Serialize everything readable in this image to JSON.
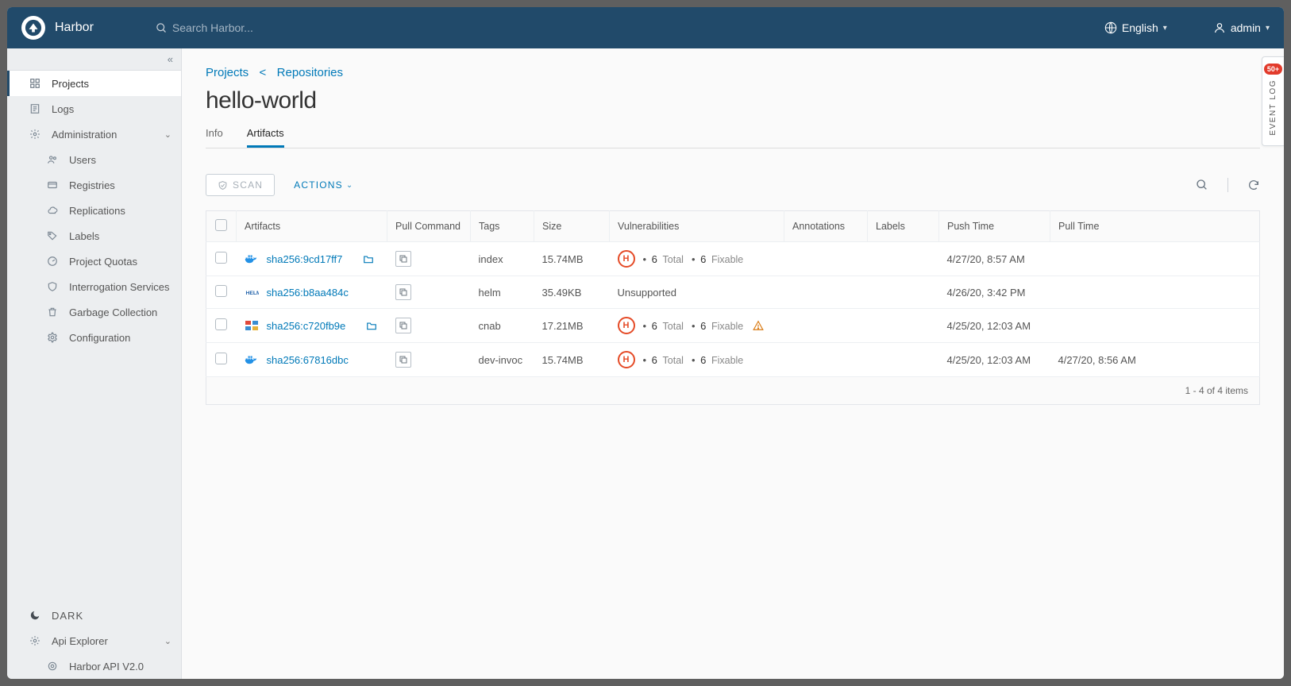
{
  "header": {
    "app_name": "Harbor",
    "search_placeholder": "Search Harbor...",
    "language": "English",
    "user": "admin"
  },
  "sidebar": {
    "projects": "Projects",
    "logs": "Logs",
    "administration": "Administration",
    "admin_items": {
      "users": "Users",
      "registries": "Registries",
      "replications": "Replications",
      "labels": "Labels",
      "project_quotas": "Project Quotas",
      "interrogation": "Interrogation Services",
      "garbage_collection": "Garbage Collection",
      "configuration": "Configuration"
    },
    "dark": "DARK",
    "api_explorer": "Api Explorer",
    "harbor_api": "Harbor API V2.0"
  },
  "breadcrumb": {
    "projects": "Projects",
    "repositories": "Repositories"
  },
  "page_title": "hello-world",
  "tabs": {
    "info": "Info",
    "artifacts": "Artifacts"
  },
  "toolbar": {
    "scan": "SCAN",
    "actions": "ACTIONS"
  },
  "columns": {
    "artifacts": "Artifacts",
    "pull_command": "Pull Command",
    "tags": "Tags",
    "size": "Size",
    "vulnerabilities": "Vulnerabilities",
    "annotations": "Annotations",
    "labels": "Labels",
    "push_time": "Push Time",
    "pull_time": "Pull Time"
  },
  "rows": [
    {
      "type": "docker",
      "hash": "sha256:9cd17ff7",
      "has_folder": true,
      "tag": "index",
      "size": "15.74MB",
      "vuln_severity": "H",
      "vuln_total": "6",
      "vuln_total_label": "Total",
      "vuln_fixable": "6",
      "vuln_fixable_label": "Fixable",
      "vuln_unsupported": "",
      "warn": false,
      "push_time": "4/27/20, 8:57 AM",
      "pull_time": ""
    },
    {
      "type": "helm",
      "hash": "sha256:b8aa484c",
      "has_folder": false,
      "tag": "helm",
      "size": "35.49KB",
      "vuln_severity": "",
      "vuln_total": "",
      "vuln_total_label": "",
      "vuln_fixable": "",
      "vuln_fixable_label": "",
      "vuln_unsupported": "Unsupported",
      "warn": false,
      "push_time": "4/26/20, 3:42 PM",
      "pull_time": ""
    },
    {
      "type": "cnab",
      "hash": "sha256:c720fb9e",
      "has_folder": true,
      "tag": "cnab",
      "size": "17.21MB",
      "vuln_severity": "H",
      "vuln_total": "6",
      "vuln_total_label": "Total",
      "vuln_fixable": "6",
      "vuln_fixable_label": "Fixable",
      "vuln_unsupported": "",
      "warn": true,
      "push_time": "4/25/20, 12:03 AM",
      "pull_time": ""
    },
    {
      "type": "docker",
      "hash": "sha256:67816dbc",
      "has_folder": false,
      "tag": "dev-invoc",
      "size": "15.74MB",
      "vuln_severity": "H",
      "vuln_total": "6",
      "vuln_total_label": "Total",
      "vuln_fixable": "6",
      "vuln_fixable_label": "Fixable",
      "vuln_unsupported": "",
      "warn": false,
      "push_time": "4/25/20, 12:03 AM",
      "pull_time": "4/27/20, 8:56 AM"
    }
  ],
  "footer": "1 - 4 of 4 items",
  "event_log": {
    "badge": "50+",
    "label": "EVENT LOG"
  }
}
